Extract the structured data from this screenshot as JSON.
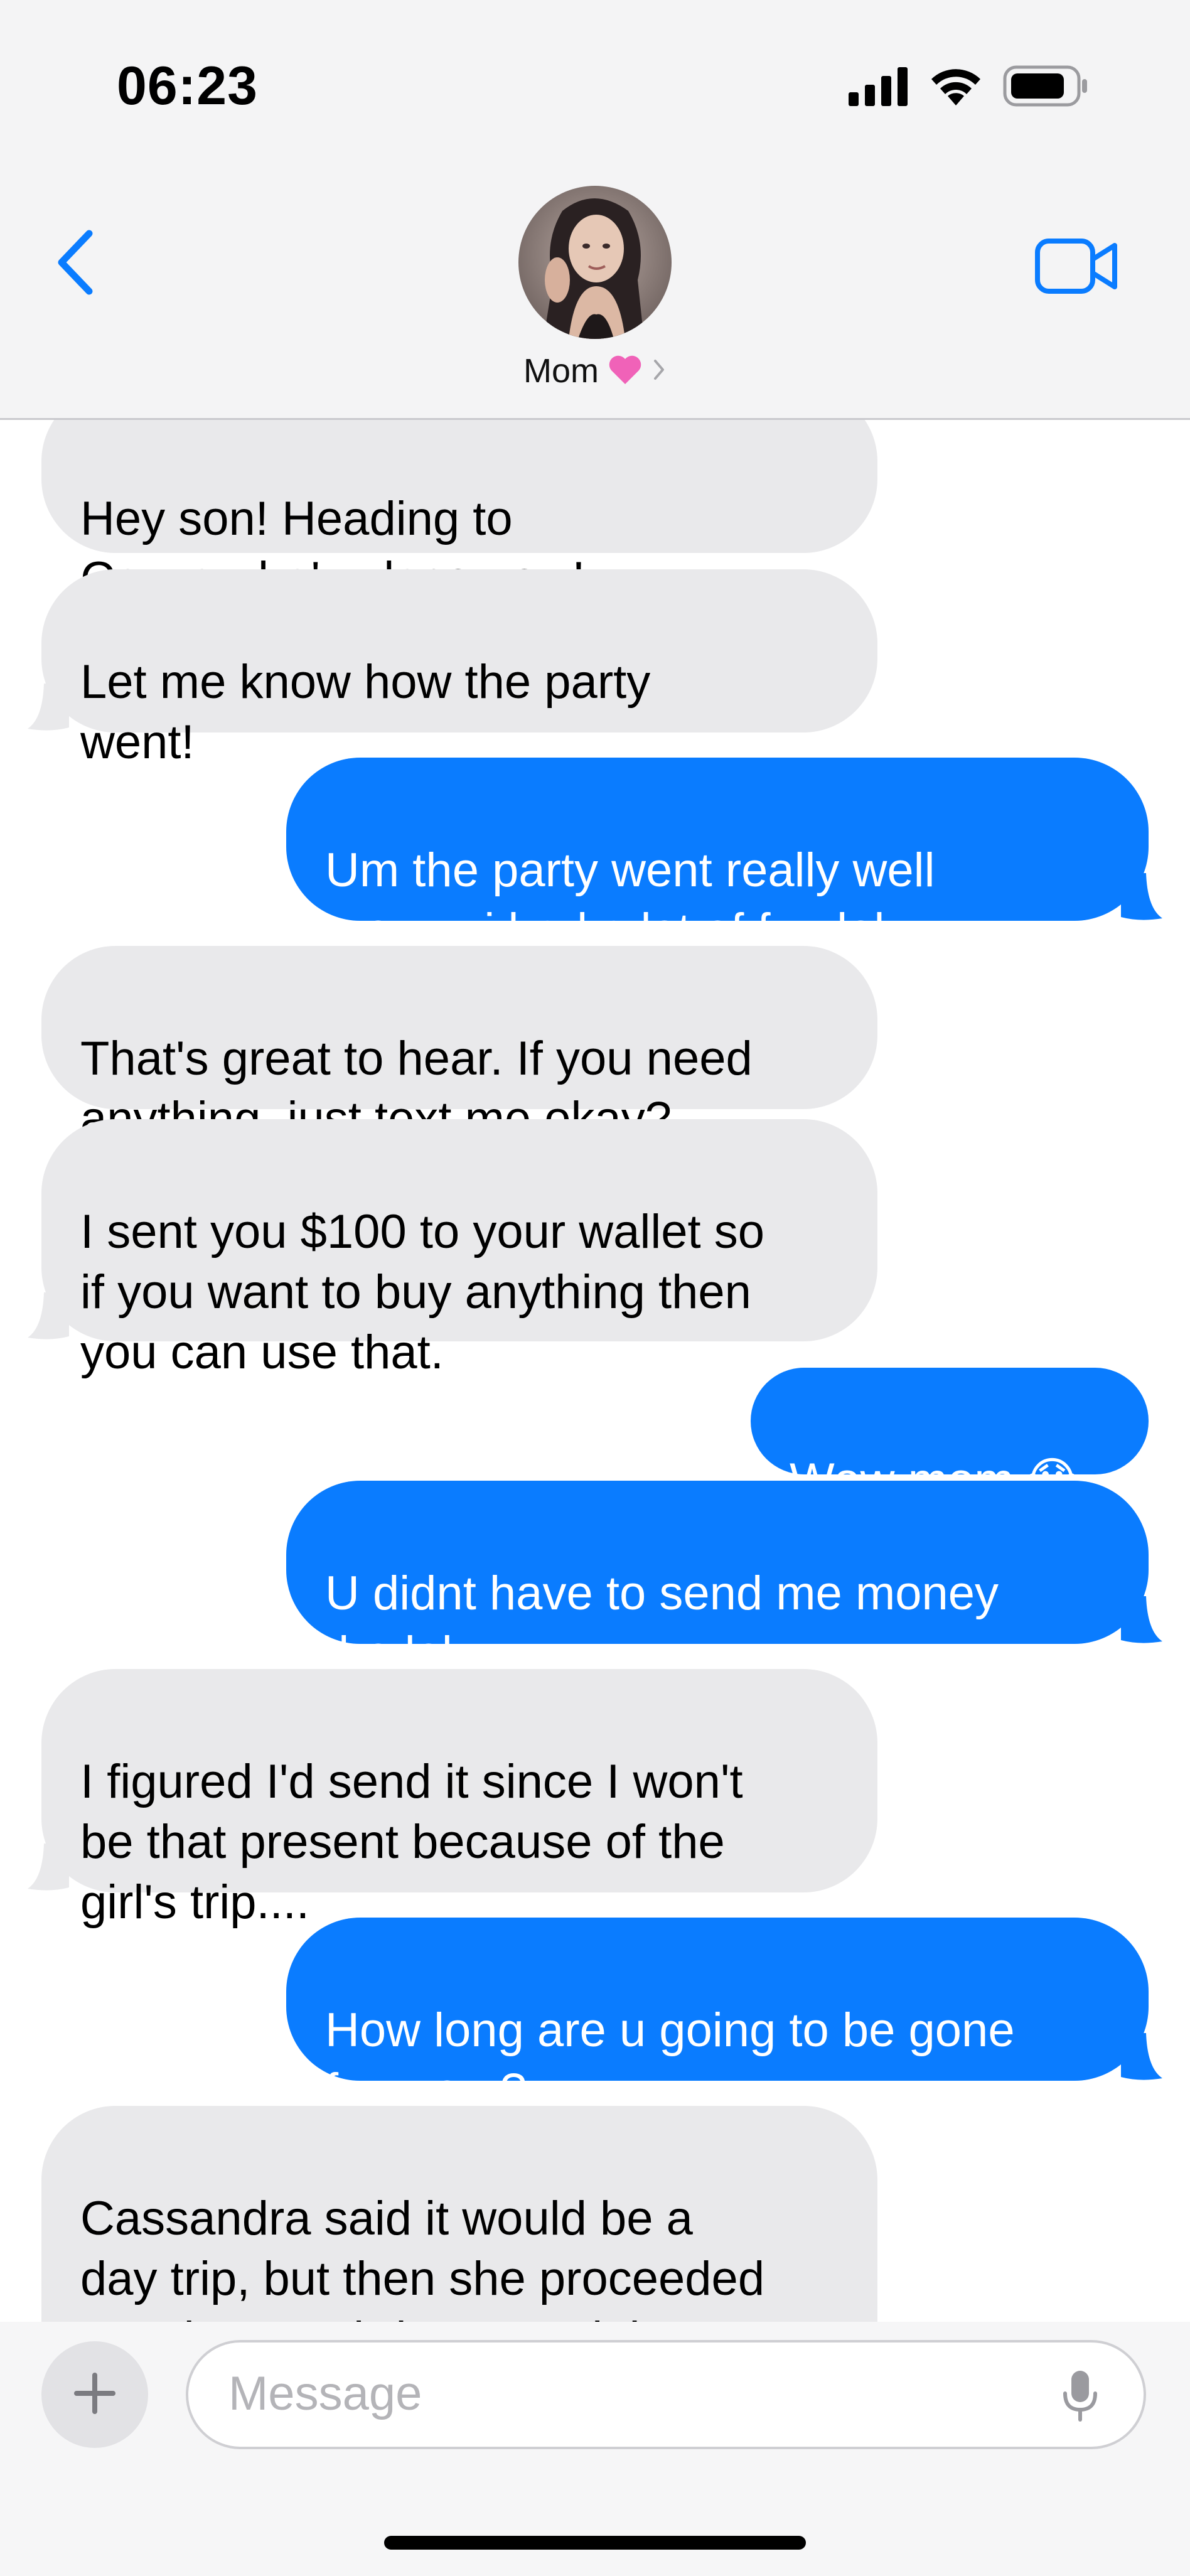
{
  "status_bar": {
    "time": "06:23",
    "signal_icon": "cellular-signal-icon",
    "wifi_icon": "wifi-icon",
    "battery_icon": "battery-icon"
  },
  "header": {
    "back_icon": "chevron-left-icon",
    "contact_name": "Mom",
    "contact_emoji": "💗",
    "contact_chevron": "›",
    "video_icon": "video-camera-icon"
  },
  "colors": {
    "outgoing_bubble": "#0a7cff",
    "incoming_bubble": "#e9e9eb",
    "accent": "#0a7cff"
  },
  "messages": [
    {
      "sender": "mom",
      "text": "Hey son! Heading to\nCassandra's place now!"
    },
    {
      "sender": "mom",
      "text": "Let me know how the party\nwent!"
    },
    {
      "sender": "me",
      "text": "Um the party went really well\nmom... i had a lot of fun lol"
    },
    {
      "sender": "mom",
      "text": "That's great to hear. If you need\nanything, just text me okay?"
    },
    {
      "sender": "mom",
      "text": "I sent you $100 to your wallet so\nif you want to buy anything then\nyou can use that."
    },
    {
      "sender": "me",
      "text": "Wow mom 😱"
    },
    {
      "sender": "me",
      "text": "U didnt have to send me money\ntho lol"
    },
    {
      "sender": "mom",
      "text": "I figured I'd send it since I won't\nbe that present because of the\ngirl's trip...."
    },
    {
      "sender": "me",
      "text": "How long are u going to be gone\nfor mom?"
    },
    {
      "sender": "mom",
      "text": "Cassandra said it would be a\nday trip, but then she proceeded\nto ask me to bring overnight\nclothes..."
    }
  ],
  "input": {
    "plus_icon": "plus-icon",
    "placeholder": "Message",
    "mic_icon": "microphone-icon"
  }
}
